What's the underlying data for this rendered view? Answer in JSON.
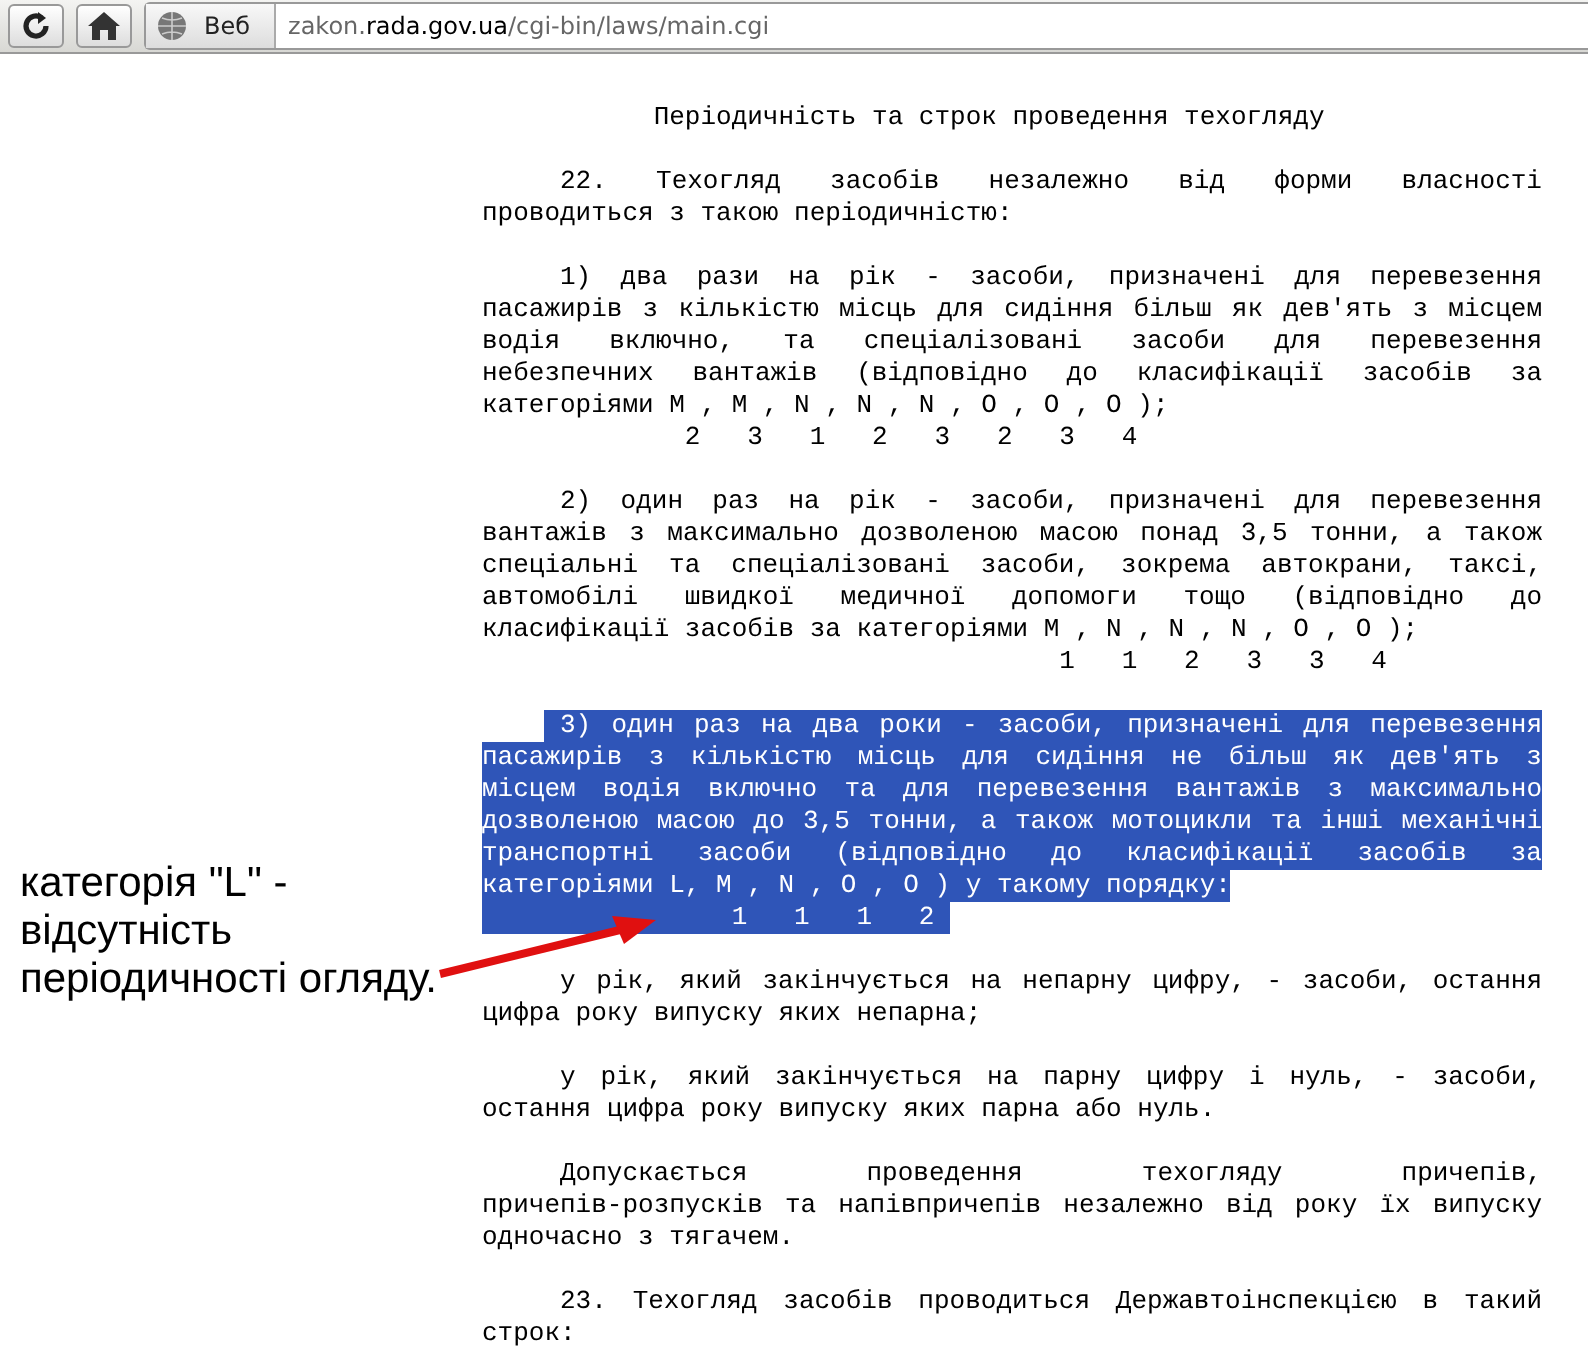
{
  "toolbar": {
    "address": {
      "label": "Веб",
      "url_parts": [
        {
          "text": "zakon.",
          "emphasis": false
        },
        {
          "text": "rada.gov.ua",
          "emphasis": true
        },
        {
          "text": "/cgi-bin/laws/main.cgi",
          "emphasis": false
        }
      ]
    }
  },
  "document": {
    "blocks": [
      {
        "kind": "heading",
        "selected": false,
        "lines": [
          "Періодичність та строк проведення техогляду"
        ]
      },
      {
        "kind": "paragraph",
        "selected": false,
        "lines": [
          "22. Техогляд засобів незалежно від форми власності",
          "проводиться з такою періодичністю:"
        ]
      },
      {
        "kind": "paragraph",
        "selected": false,
        "lines": [
          "1) два рази на рік - засоби, призначені для перевезення",
          "пасажирів з кількістю місць для сидіння більш як дев'ять з місцем",
          "водія включно, та спеціалізовані засоби для перевезення",
          "небезпечних вантажів (відповідно до класифікації засобів за",
          "категоріями M , M , N , N , N , O , O , O );"
        ]
      },
      {
        "kind": "subscripts",
        "selected": false,
        "lines": [
          "             2   3   1   2   3   2   3   4"
        ]
      },
      {
        "kind": "paragraph",
        "selected": false,
        "lines": [
          "2) один раз на рік - засоби, призначені для перевезення",
          "вантажів з максимально дозволеною масою понад 3,5 тонни, а також",
          "спеціальні та спеціалізовані засоби, зокрема автокрани, таксі,",
          "автомобілі швидкої медичної допомоги тощо (відповідно до",
          "класифікації засобів за категоріями M , N , N , N , O , O );"
        ]
      },
      {
        "kind": "subscripts",
        "selected": false,
        "lines": [
          "                                     1   1   2   3   3   4"
        ]
      },
      {
        "kind": "paragraph",
        "selected": true,
        "lines": [
          "3) один раз на два роки - засоби, призначені для перевезення",
          "пасажирів з кількістю місць для сидіння не більш як дев'ять з",
          "місцем водія включно та для перевезення вантажів з максимально",
          "дозволеною масою до 3,5 тонни, а також мотоцикли та інші механічні",
          "транспортні засоби (відповідно до класифікації засобів за",
          "категоріями L, M , N , O , O ) у такому порядку:"
        ]
      },
      {
        "kind": "subscripts",
        "selected": true,
        "lines": [
          "                1   1   1   2 "
        ]
      },
      {
        "kind": "paragraph",
        "selected": false,
        "lines": [
          "у рік, який закінчується на непарну цифру, - засоби, остання",
          "цифра року випуску яких непарна;"
        ]
      },
      {
        "kind": "paragraph",
        "selected": false,
        "lines": [
          "у рік, який закінчується на парну цифру і нуль, - засоби,",
          "остання цифра року випуску яких парна або нуль."
        ]
      },
      {
        "kind": "paragraph",
        "selected": false,
        "lines": [
          "Допускається проведення техогляду причепів,",
          "причепів-розпусків та напівпричепів незалежно від року їх випуску",
          "одночасно з тягачем."
        ]
      },
      {
        "kind": "paragraph",
        "selected": false,
        "lines": [
          "23. Техогляд засобів проводиться Державтоінспекцією в такий",
          "строк:"
        ]
      }
    ]
  },
  "annotation": {
    "text": "категорія \"L\" - відсутність періодичності огляду."
  }
}
